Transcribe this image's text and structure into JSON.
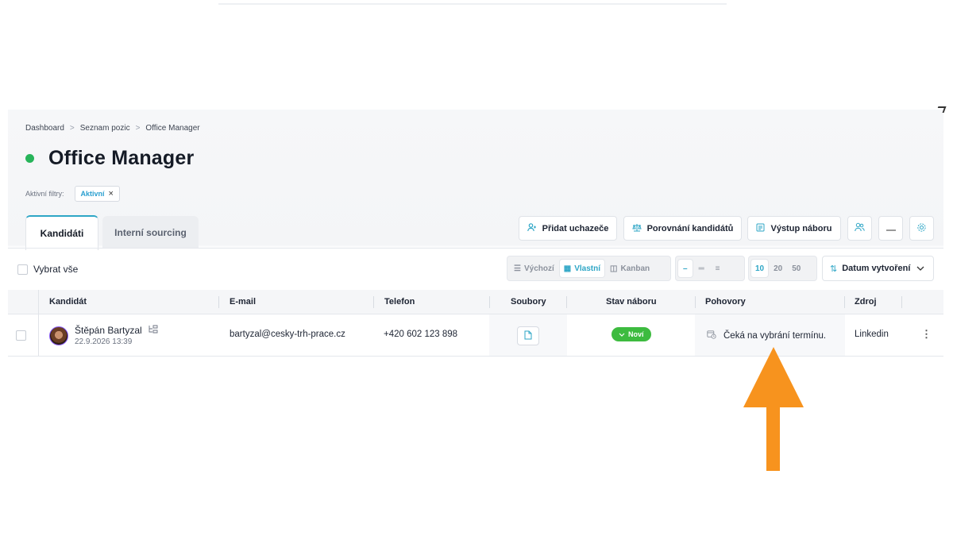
{
  "breadcrumb": {
    "items": [
      "Dashboard",
      "Seznam pozic",
      "Office Manager"
    ],
    "separator": ">"
  },
  "page": {
    "title": "Office Manager",
    "status_color": "#27b45a"
  },
  "filters": {
    "label": "Aktivní filtry:",
    "chips": [
      "Aktivní"
    ]
  },
  "tabs": [
    {
      "label": "Kandidáti",
      "active": true
    },
    {
      "label": "Interní sourcing",
      "active": false
    }
  ],
  "actions": {
    "add_applicant": "Přidat uchazeče",
    "compare_candidates": "Porovnání kandidátů",
    "hiring_output": "Výstup náboru"
  },
  "toolbar": {
    "select_all": "Vybrat vše",
    "views": [
      {
        "label": "Výchozí",
        "icon": "list-icon",
        "active": false
      },
      {
        "label": "Vlastní",
        "icon": "grid-icon",
        "active": true
      },
      {
        "label": "Kanban",
        "icon": "kanban-icon",
        "active": false
      }
    ],
    "page_sizes": [
      "10",
      "20",
      "50"
    ],
    "page_size_selected": "10",
    "sort_label": "Datum vytvoření"
  },
  "table": {
    "columns": [
      "Kandidát",
      "E-mail",
      "Telefon",
      "Soubory",
      "Stav náboru",
      "Pohovory",
      "Zdroj"
    ],
    "rows": [
      {
        "name": "Štěpán Bartyzal",
        "date": "22.9.2026 13:39",
        "email": "bartyzal@cesky-trh-prace.cz",
        "phone": "+420 602 123 898",
        "status": "Noví",
        "interview": "Čeká na vybrání termínu.",
        "source": "Linkedin"
      }
    ]
  },
  "colors": {
    "accent": "#2ea6c6",
    "status_green": "#3dbb3f",
    "arrow_orange": "#f7931e"
  }
}
